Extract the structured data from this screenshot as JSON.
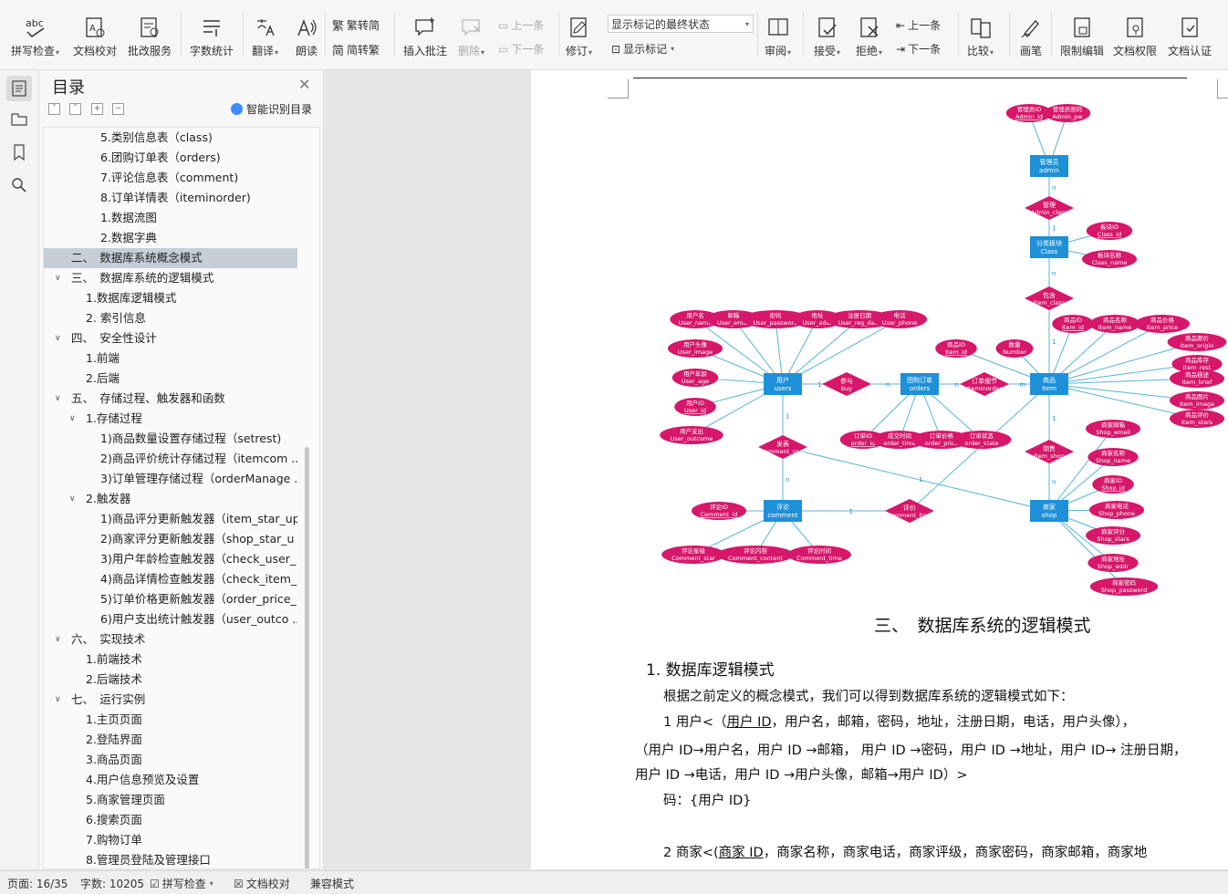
{
  "ribbon": {
    "spellcheck": "拼写检查",
    "doc_check": "文档校对",
    "batch_service": "批改服务",
    "word_count": "字数统计",
    "translate": "翻译",
    "read_aloud": "朗读",
    "trad_to_simp": "繁转简",
    "simp_to_trad": "简转繁",
    "insert_comment": "插入批注",
    "delete": "删除",
    "prev_comment": "上一条",
    "next_comment": "下一条",
    "revise": "修订",
    "markup_state": "显示标记的最终状态",
    "show_markup": "显示标记",
    "review": "审阅",
    "accept": "接受",
    "reject": "拒绝",
    "prev_change": "上一条",
    "next_change": "下一条",
    "compare": "比较",
    "pen": "画笔",
    "restrict_edit": "限制编辑",
    "doc_permission": "文档权限",
    "doc_cert": "文档认证"
  },
  "toc": {
    "title": "目录",
    "smart_label": "智能识别目录",
    "items": [
      {
        "label": "5.类别信息表（class)",
        "level": 3
      },
      {
        "label": "6.团购订单表（orders)",
        "level": 3
      },
      {
        "label": "7.评论信息表（comment)",
        "level": 3
      },
      {
        "label": "8.订单详情表（iteminorder)",
        "level": 3
      },
      {
        "label": "1.数据流图",
        "level": 3
      },
      {
        "label": "2.数据字典",
        "level": 3
      },
      {
        "label": "二、　数据库系统概念模式",
        "level": 1,
        "selected": true
      },
      {
        "label": "三、　数据库系统的逻辑模式",
        "level": 1,
        "expanded": true
      },
      {
        "label": "1.数据库逻辑模式",
        "level": 2
      },
      {
        "label": "2. 索引信息",
        "level": 2
      },
      {
        "label": "四、　安全性设计",
        "level": 1,
        "expanded": true
      },
      {
        "label": "1.前端",
        "level": 2
      },
      {
        "label": "2.后端",
        "level": 2
      },
      {
        "label": "五、　存储过程、触发器和函数",
        "level": 1,
        "expanded": true
      },
      {
        "label": "1.存储过程",
        "level": 2,
        "expanded": true
      },
      {
        "label": "1)商品数量设置存储过程（setrest)",
        "level": 3
      },
      {
        "label": "2)商品评价统计存储过程（itemcom ...",
        "level": 3
      },
      {
        "label": "3)订单管理存储过程（orderManage ...",
        "level": 3
      },
      {
        "label": "2.触发器",
        "level": 2,
        "expanded": true
      },
      {
        "label": "1)商品评分更新触发器（item_star_up ...",
        "level": 3
      },
      {
        "label": "2)商家评分更新触发器（shop_star_u ...",
        "level": 3
      },
      {
        "label": "3)用户年龄检查触发器（check_user_ ...",
        "level": 3
      },
      {
        "label": "4)商品详情检查触发器（check_item_ ...",
        "level": 3
      },
      {
        "label": "5)订单价格更新触发器（order_price_ ...",
        "level": 3
      },
      {
        "label": "6)用户支出统计触发器（user_outco ...",
        "level": 3
      },
      {
        "label": "六、　实现技术",
        "level": 1,
        "expanded": true
      },
      {
        "label": "1.前端技术",
        "level": 2
      },
      {
        "label": "2.后端技术",
        "level": 2
      },
      {
        "label": "七、　运行实例",
        "level": 1,
        "expanded": true
      },
      {
        "label": "1.主页页面",
        "level": 2
      },
      {
        "label": "2.登陆界面",
        "level": 2
      },
      {
        "label": "3.商品页面",
        "level": 2
      },
      {
        "label": "4.用户信息预览及设置",
        "level": 2
      },
      {
        "label": "5.商家管理页面",
        "level": 2
      },
      {
        "label": "6.搜索页面",
        "level": 2
      },
      {
        "label": "7.购物订单",
        "level": 2
      },
      {
        "label": "8.管理员登陆及管理接口",
        "level": 2
      }
    ]
  },
  "erd": {
    "entities": [
      {
        "cn": "管理员",
        "en": "admin"
      },
      {
        "cn": "分类板块",
        "en": "Class"
      },
      {
        "cn": "用户",
        "en": "users"
      },
      {
        "cn": "团购订单",
        "en": "orders"
      },
      {
        "cn": "商品",
        "en": "item"
      },
      {
        "cn": "评论",
        "en": "comment"
      },
      {
        "cn": "商家",
        "en": "shop"
      }
    ],
    "relationships": [
      {
        "cn": "管理",
        "en": "Admin_class"
      },
      {
        "cn": "包含",
        "en": "Item_class"
      },
      {
        "cn": "参与",
        "en": "buy"
      },
      {
        "cn": "订单细节",
        "en": "Iteminorder"
      },
      {
        "cn": "发表",
        "en": "Comment_user"
      },
      {
        "cn": "销售",
        "en": "Item_shop"
      },
      {
        "cn": "评价",
        "en": "Comment_item"
      }
    ],
    "attributes": [
      {
        "cn": "管理员ID",
        "en": "Admin_id",
        "key": true
      },
      {
        "cn": "管理员密码",
        "en": "Admin_pw"
      },
      {
        "cn": "板块ID",
        "en": "Class_id",
        "key": true
      },
      {
        "cn": "板块名称",
        "en": "Class_name"
      },
      {
        "cn": "用户名",
        "en": "User_name"
      },
      {
        "cn": "邮箱",
        "en": "User_email"
      },
      {
        "cn": "密码",
        "en": "User_password"
      },
      {
        "cn": "地址",
        "en": "User_addr"
      },
      {
        "cn": "注册日期",
        "en": "User_reg_date"
      },
      {
        "cn": "电话",
        "en": "User_phone"
      },
      {
        "cn": "用户头像",
        "en": "User_image"
      },
      {
        "cn": "用户年龄",
        "en": "User_age"
      },
      {
        "cn": "用户ID",
        "en": "User_id",
        "key": true
      },
      {
        "cn": "用户支出",
        "en": "User_outcome"
      },
      {
        "cn": "商品ID",
        "en": "Item_id",
        "key": true
      },
      {
        "cn": "数量",
        "en": "Number"
      },
      {
        "cn": "订单ID",
        "en": "order_id",
        "key": true
      },
      {
        "cn": "成交时间",
        "en": "order_time"
      },
      {
        "cn": "订单价格",
        "en": "order_price"
      },
      {
        "cn": "订单状态",
        "en": "order_state"
      },
      {
        "cn": "商品ID",
        "en": "Item_id",
        "key": true
      },
      {
        "cn": "商品名称",
        "en": "Item_name"
      },
      {
        "cn": "商品价格",
        "en": "Item_price"
      },
      {
        "cn": "商品原价",
        "en": "Item_origin"
      },
      {
        "cn": "商品库存",
        "en": "Item_rest"
      },
      {
        "cn": "商品描述",
        "en": "Item_brief"
      },
      {
        "cn": "商品图片",
        "en": "Item_image"
      },
      {
        "cn": "商品评价",
        "en": "Item_stars"
      },
      {
        "cn": "评论ID",
        "en": "Comment_id",
        "key": true
      },
      {
        "cn": "评论星级",
        "en": "Comment_star"
      },
      {
        "cn": "评论内容",
        "en": "Comment_content"
      },
      {
        "cn": "评论时间",
        "en": "Comment_time"
      },
      {
        "cn": "商家邮箱",
        "en": "Shop_email"
      },
      {
        "cn": "商家名称",
        "en": "Shop_name"
      },
      {
        "cn": "商家ID",
        "en": "Shop_id",
        "key": true
      },
      {
        "cn": "商家电话",
        "en": "Shop_phone"
      },
      {
        "cn": "商家评分",
        "en": "Shop_stars"
      },
      {
        "cn": "商家地址",
        "en": "Shop_addr"
      },
      {
        "cn": "商家密码",
        "en": "Shop_password"
      }
    ],
    "cardinalities": [
      "n",
      "1",
      "n",
      "1",
      "1",
      "n",
      "n",
      "m",
      "1",
      "n",
      "1",
      "n",
      "1",
      "n",
      "1",
      "n"
    ]
  },
  "doc": {
    "heading_chapter": "三、　数据库系统的逻辑模式",
    "heading_section": "1.  数据库逻辑模式",
    "intro": "根据之前定义的概念模式，我们可以得到数据库系统的逻辑模式如下：",
    "user_a": "1  用户<（",
    "user_key": "用户 ID",
    "user_b": "，用户名，邮箱，密码，地址，注册日期，电话，用户头像），",
    "user_fd1": "（用户 ID→用户名，用户 ID →邮箱，  用户 ID →密码，用户 ID →地址，用户 ID→  注册日期，",
    "user_fd2": "用户  ID →电话，用户 ID →用户头像，邮箱→用户  ID）>",
    "user_code": "码：{用户  ID}",
    "shop_a": "2  商家<(",
    "shop_key": "商家 ID",
    "shop_b": "，商家名称，商家电话，商家评级，商家密码，商家邮箱，商家地"
  },
  "status": {
    "page": "页面: 16/35",
    "words": "字数: 10205",
    "spell": "拼写检查",
    "doc_check": "文档校对",
    "compat": "兼容模式"
  },
  "colors": {
    "erd_entity": "#1e90d8",
    "erd_attr": "#d6176a",
    "erd_line": "#55b4d8",
    "toc_selected": "#c6ced7"
  }
}
